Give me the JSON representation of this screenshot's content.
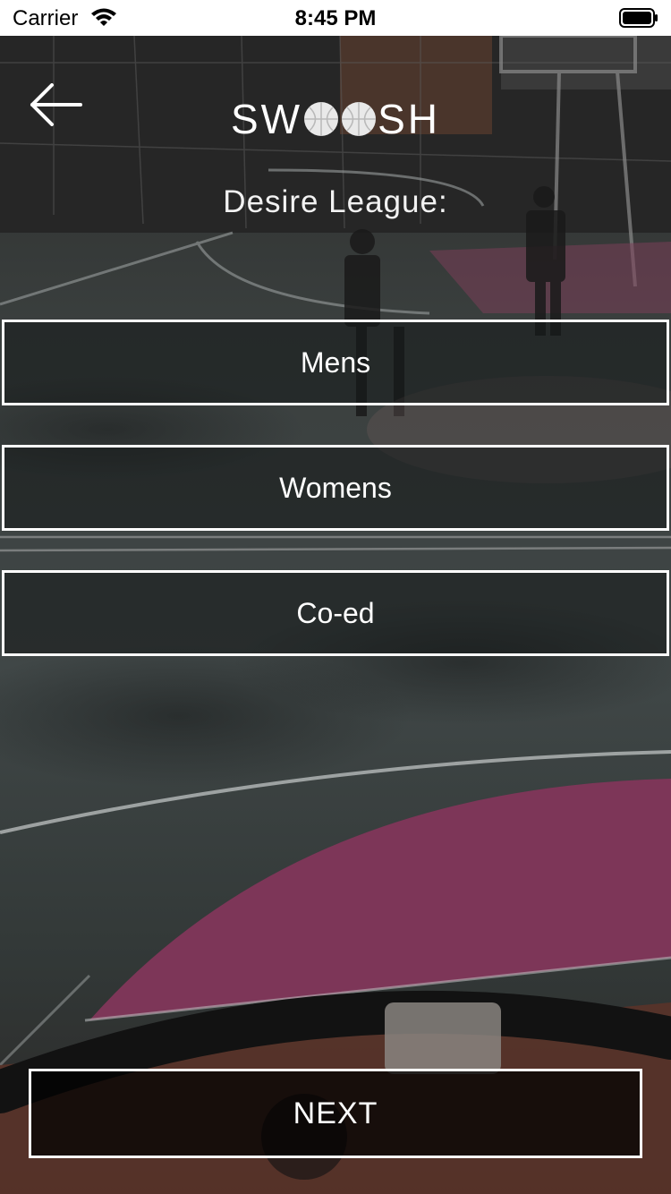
{
  "status_bar": {
    "carrier": "Carrier",
    "time": "8:45 PM",
    "icons": [
      "wifi-icon",
      "battery-icon"
    ]
  },
  "header": {
    "back_icon": "arrow-left-icon",
    "logo_text_left": "SW",
    "logo_text_right": "SH",
    "logo_icons": [
      "basketball-icon",
      "basketball-icon"
    ],
    "title": "Desire League:"
  },
  "options": [
    {
      "label": "Mens"
    },
    {
      "label": "Womens"
    },
    {
      "label": "Co-ed"
    }
  ],
  "footer": {
    "next_label": "NEXT"
  },
  "colors": {
    "button_border": "#ffffff",
    "text": "#ffffff",
    "court_pink": "#8a3a5c",
    "court_concrete": "#3c4343"
  }
}
